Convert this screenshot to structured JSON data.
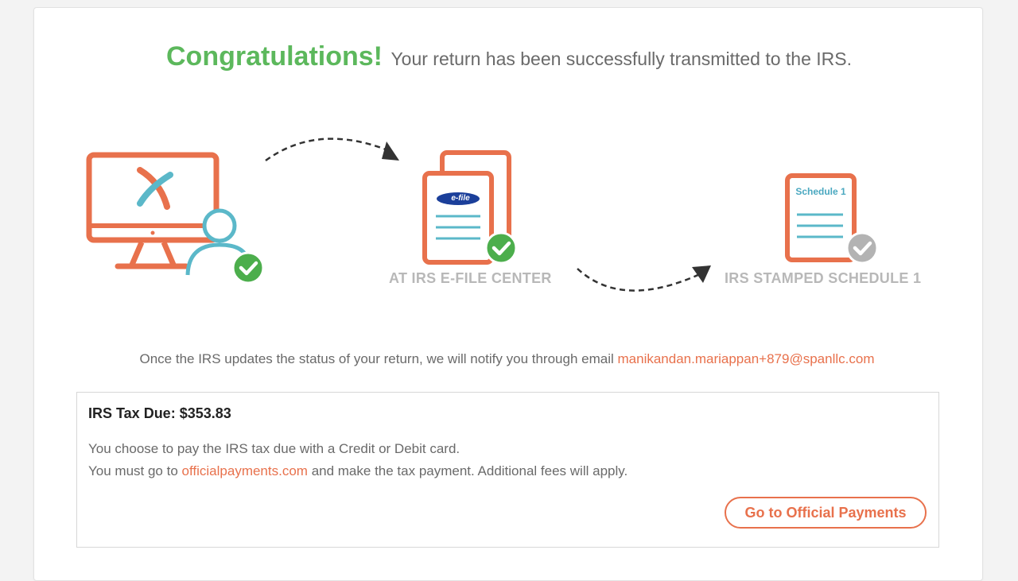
{
  "header": {
    "congrats": "Congratulations!",
    "message": "Your return has been successfully transmitted to the IRS."
  },
  "steps": [
    {
      "icon": "computer-user-icon",
      "label": "",
      "status": "complete"
    },
    {
      "icon": "efile-document-icon",
      "label": "AT IRS E-FILE CENTER",
      "badge_text": "e-file",
      "status": "complete"
    },
    {
      "icon": "schedule-document-icon",
      "label": "IRS STAMPED SCHEDULE 1",
      "doc_title": "Schedule 1",
      "status": "pending"
    }
  ],
  "notify": {
    "text": "Once the IRS updates the status of your return, we will notify you through email",
    "email": "manikandan.mariappan+879@spanllc.com"
  },
  "tax": {
    "title": "IRS Tax Due: $353.83",
    "line1": "You choose to pay the IRS tax due with a Credit or Debit card.",
    "line2_prefix": "You must go to",
    "line2_link": "officialpayments.com",
    "line2_suffix": "and make the tax payment. Additional fees will apply.",
    "button_label": "Go to Official Payments"
  },
  "colors": {
    "accent": "#e8714c",
    "success": "#5cb85c",
    "pending": "#b3b3b3",
    "user_icon": "#5bb8c9"
  }
}
